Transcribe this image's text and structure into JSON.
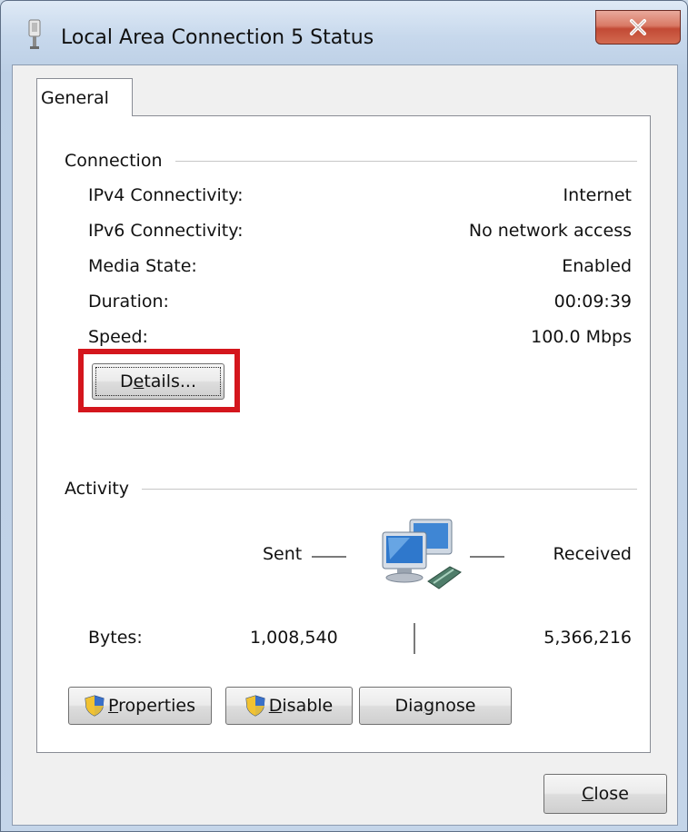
{
  "window": {
    "title": "Local Area Connection 5 Status",
    "close_glyph": "X",
    "icon": "network-adapter-icon"
  },
  "tabs": [
    {
      "label": "General",
      "selected": true
    }
  ],
  "connection": {
    "group_label": "Connection",
    "rows": [
      {
        "label": "IPv4 Connectivity:",
        "value": "Internet"
      },
      {
        "label": "IPv6 Connectivity:",
        "value": "No network access"
      },
      {
        "label": "Media State:",
        "value": "Enabled"
      },
      {
        "label": "Duration:",
        "value": "00:09:39"
      },
      {
        "label": "Speed:",
        "value": "100.0 Mbps"
      }
    ],
    "details_button": {
      "pre": "D",
      "mnemonic": "e",
      "post": "tails..."
    }
  },
  "activity": {
    "group_label": "Activity",
    "sent_label": "Sent",
    "received_label": "Received",
    "bytes_label": "Bytes:",
    "bytes_sent": "1,008,540",
    "bytes_received": "5,366,216",
    "icon": "network-computers-icon"
  },
  "buttons": {
    "properties": {
      "mnemonic": "P",
      "rest": "roperties",
      "icon": "uac-shield-icon"
    },
    "disable": {
      "mnemonic": "D",
      "rest": "isable",
      "icon": "uac-shield-icon"
    },
    "diagnose": {
      "pre": "Dia",
      "mnemonic": "g",
      "post": "nose"
    },
    "close": {
      "mnemonic": "C",
      "rest": "lose"
    }
  },
  "colors": {
    "highlight": "#d4161d",
    "titlebar_close": "#c24a35"
  }
}
